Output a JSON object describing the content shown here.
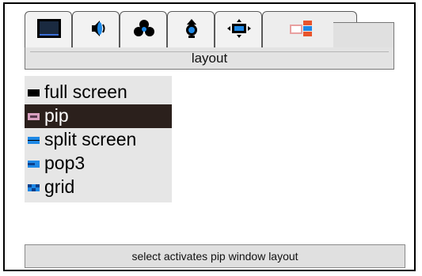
{
  "header": {
    "title": "layout"
  },
  "tabs": [
    {
      "name": "monitor"
    },
    {
      "name": "audio"
    },
    {
      "name": "color"
    },
    {
      "name": "image"
    },
    {
      "name": "scaling"
    },
    {
      "name": "layout",
      "selected": true
    }
  ],
  "menu": {
    "items": [
      {
        "label": "full screen",
        "icon": "full-screen-icon"
      },
      {
        "label": "pip",
        "icon": "pip-icon",
        "selected": true
      },
      {
        "label": "split screen",
        "icon": "split-screen-icon"
      },
      {
        "label": "pop3",
        "icon": "pop3-icon"
      },
      {
        "label": "grid",
        "icon": "grid-icon"
      }
    ]
  },
  "status": {
    "text": "select activates pip window layout"
  },
  "colors": {
    "selection_bg": "#2b201c",
    "icon_blue": "#1e88e5",
    "panel_bg": "#e6e6e6"
  }
}
